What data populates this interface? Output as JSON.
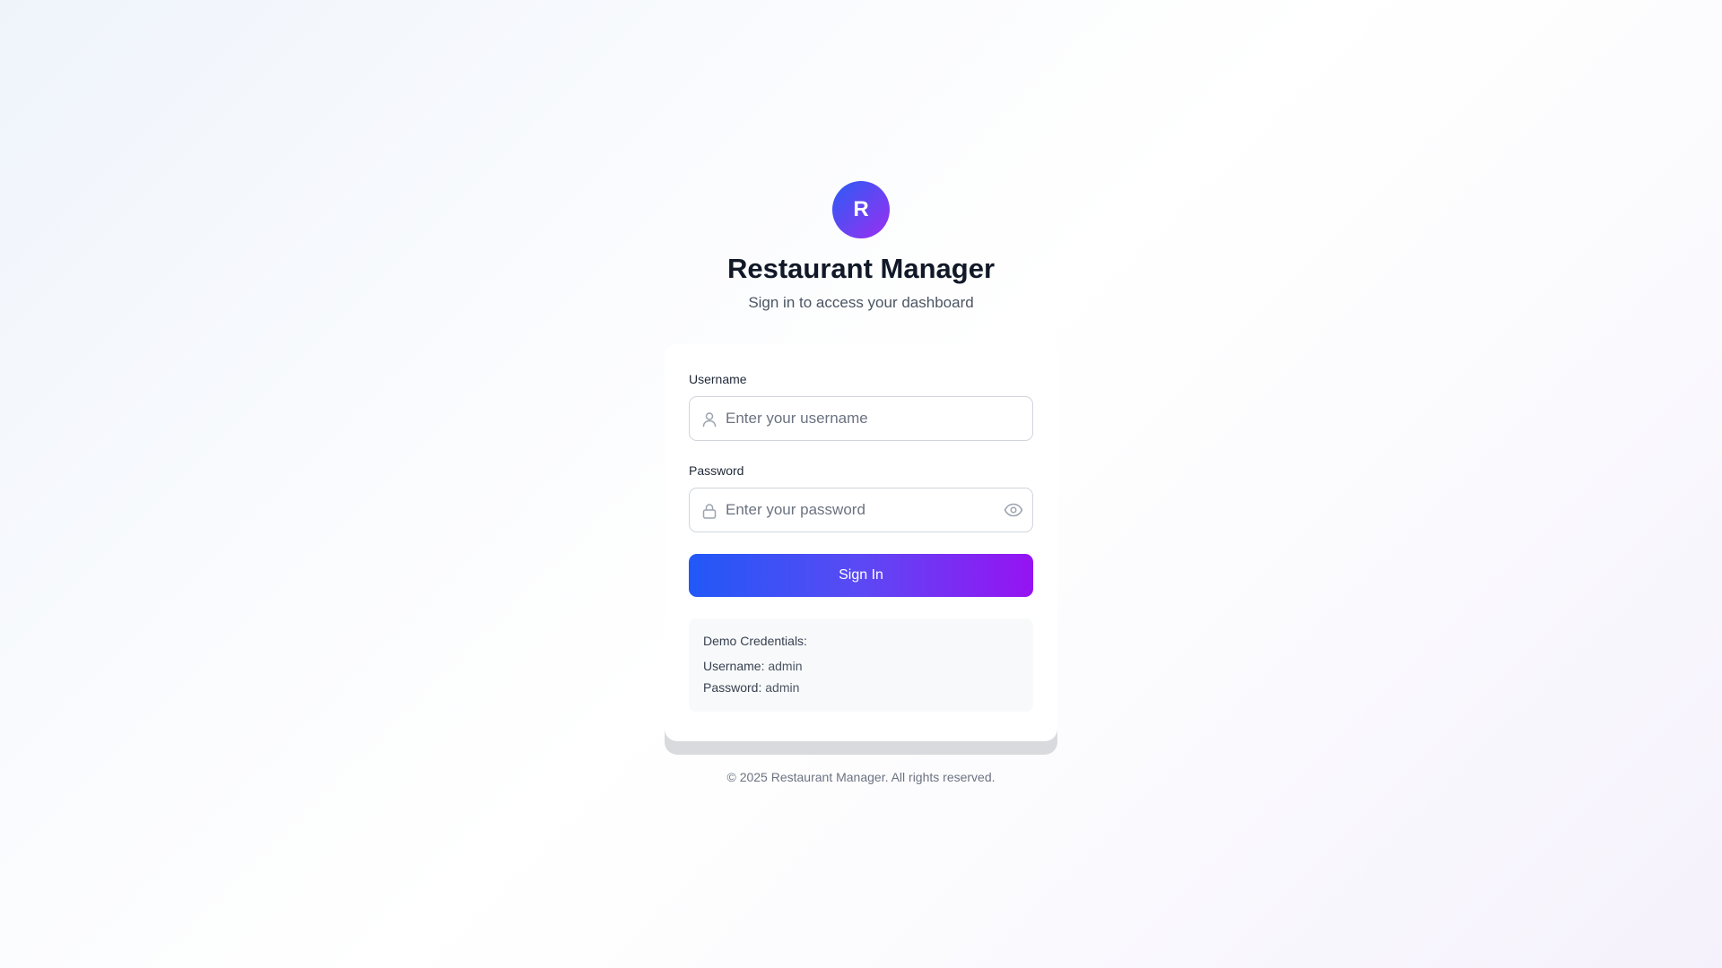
{
  "brand": {
    "logo_letter": "R",
    "title": "Restaurant Manager",
    "subtitle": "Sign in to access your dashboard"
  },
  "form": {
    "username_label": "Username",
    "username_placeholder": "Enter your username",
    "username_value": "",
    "password_label": "Password",
    "password_placeholder": "Enter your password",
    "password_value": "",
    "submit_label": "Sign In"
  },
  "demo": {
    "heading": "Demo Credentials:",
    "username_key": "Username:",
    "username_value": "admin",
    "password_key": "Password:",
    "password_value": "admin"
  },
  "footer": {
    "text": "© 2025 Restaurant Manager. All rights reserved."
  },
  "icons": {
    "username": "user-icon",
    "password": "lock-icon",
    "toggle": "eye-icon"
  },
  "colors": {
    "gradient_start": "#2158f7",
    "gradient_end": "#9613f2",
    "title": "#111827",
    "muted": "#4b5563"
  }
}
